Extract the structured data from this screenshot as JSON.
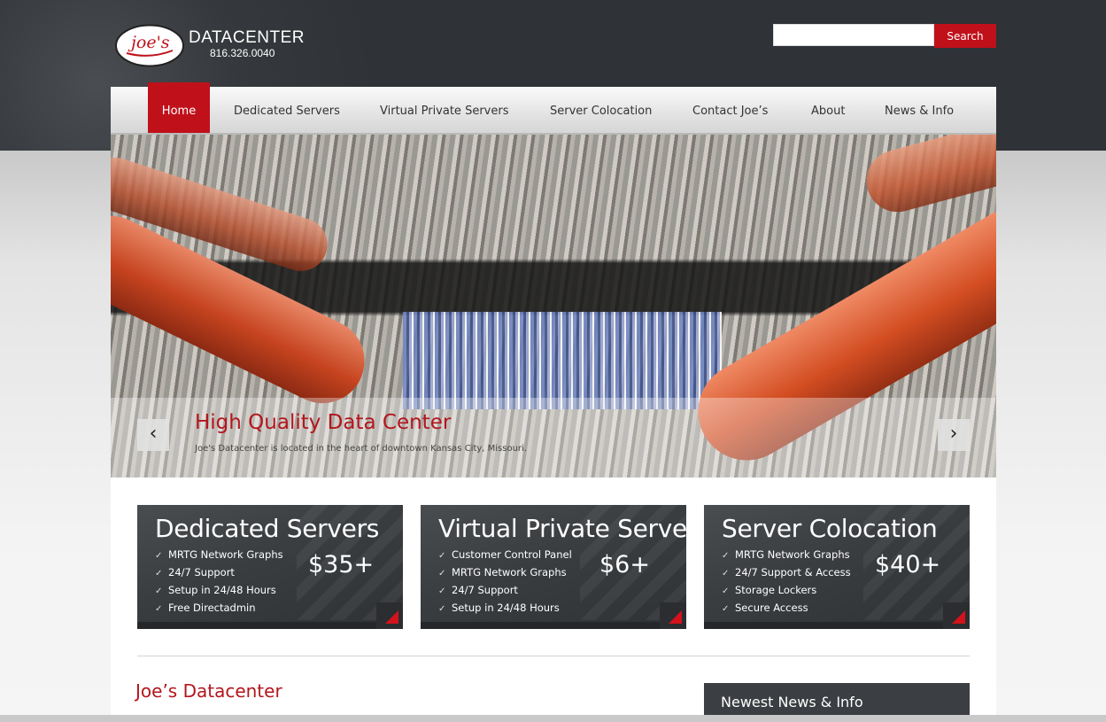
{
  "header": {
    "logo_text": "Joe's",
    "brand": "DATACENTER",
    "phone": "816.326.0040",
    "search": {
      "placeholder": "",
      "value": "",
      "button_label": "Search"
    },
    "colors": {
      "accent": "#c0111b",
      "header_bg": "#35383c"
    }
  },
  "nav": {
    "items": [
      {
        "label": "Home",
        "active": true
      },
      {
        "label": "Dedicated Servers"
      },
      {
        "label": "Virtual Private Servers"
      },
      {
        "label": "Server Colocation"
      },
      {
        "label": "Contact Joe’s"
      },
      {
        "label": "About"
      },
      {
        "label": "News & Info"
      }
    ]
  },
  "slider": {
    "title": "High Quality Data Center",
    "subtitle": "Joe's Datacenter is located in the heart of downtown Kansas City, Missouri.",
    "prev_icon": "chevron-left-icon",
    "next_icon": "chevron-right-icon"
  },
  "offers": [
    {
      "title": "Dedicated Servers",
      "price": "$35+",
      "features": [
        "MRTG Network Graphs",
        "24/7 Support",
        "Setup in 24/48 Hours",
        "Free Directadmin"
      ]
    },
    {
      "title": "Virtual Private Servers",
      "price": "$6+",
      "features": [
        "Customer Control Panel",
        "MRTG Network Graphs",
        "24/7 Support",
        "Setup in 24/48 Hours"
      ]
    },
    {
      "title": "Server Colocation",
      "price": "$40+",
      "features": [
        "MRTG Network Graphs",
        "24/7 Support & Access",
        "Storage Lockers",
        "Secure Access"
      ]
    }
  ],
  "check_glyph": "✓",
  "about": {
    "title": "Joe’s Datacenter"
  },
  "news": {
    "title": "Newest News & Info"
  }
}
